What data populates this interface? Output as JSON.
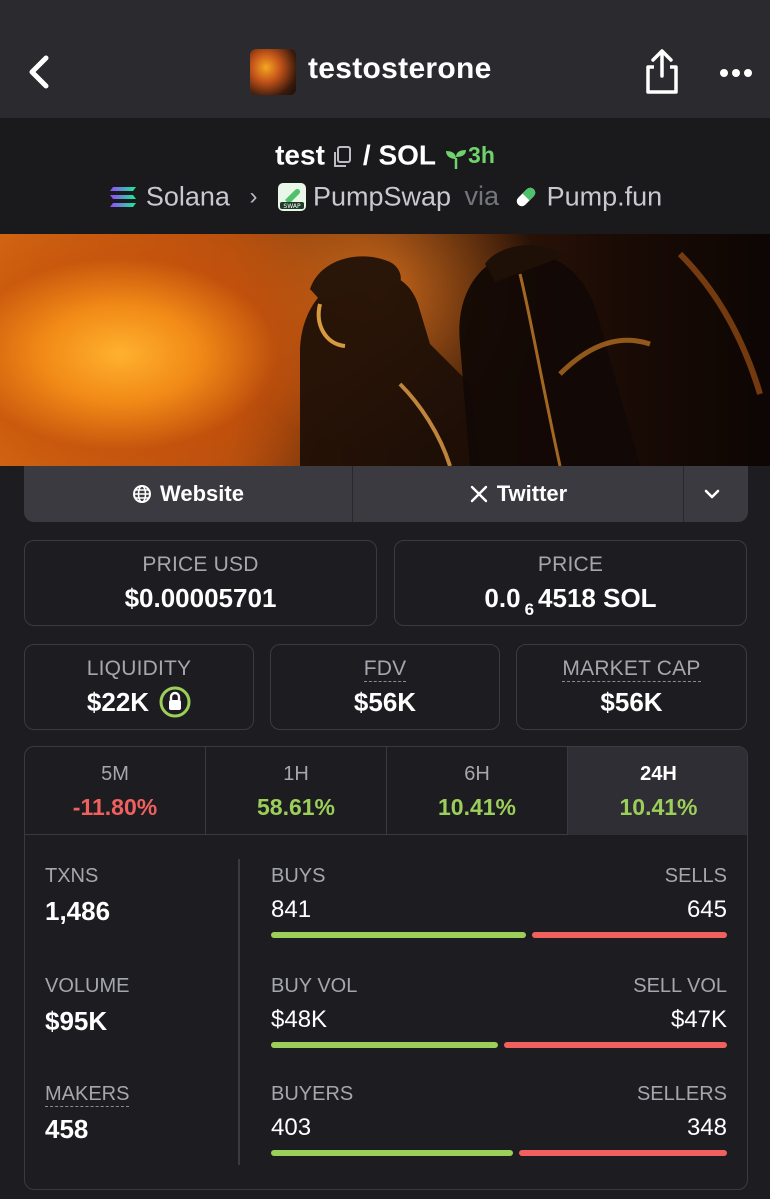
{
  "header": {
    "token_name": "testosterone"
  },
  "pair": {
    "base": "test",
    "separator": "/",
    "quote": "SOL",
    "age": "3h",
    "chain": "Solana",
    "dex": "PumpSwap",
    "via_label": "via",
    "launchpad": "Pump.fun"
  },
  "links": {
    "website": "Website",
    "twitter": "Twitter"
  },
  "stats": {
    "price_usd_label": "PRICE USD",
    "price_usd": "$0.00005701",
    "price_label": "PRICE",
    "price_prefix": "0.0",
    "price_subscript": "6",
    "price_suffix": "4518 SOL",
    "liquidity_label": "LIQUIDITY",
    "liquidity": "$22K",
    "fdv_label": "FDV",
    "fdv": "$56K",
    "mcap_label": "MARKET CAP",
    "mcap": "$56K"
  },
  "timeframes": [
    {
      "label": "5M",
      "change": "-11.80%"
    },
    {
      "label": "1H",
      "change": "58.61%"
    },
    {
      "label": "6H",
      "change": "10.41%"
    },
    {
      "label": "24H",
      "change": "10.41%"
    }
  ],
  "active_timeframe": "24H",
  "metrics": {
    "txns_label": "TXNS",
    "txns": "1,486",
    "volume_label": "VOLUME",
    "volume": "$95K",
    "makers_label": "MAKERS",
    "makers": "458"
  },
  "breakdown": {
    "buys_label": "BUYS",
    "buys": "841",
    "sells_label": "SELLS",
    "sells": "645",
    "buy_share": 0.566,
    "buy_vol_label": "BUY VOL",
    "buy_vol": "$48K",
    "sell_vol_label": "SELL VOL",
    "sell_vol": "$47K",
    "buy_vol_share": 0.505,
    "buyers_label": "BUYERS",
    "buyers": "403",
    "sellers_label": "SELLERS",
    "sellers": "348",
    "buyers_share": 0.537
  },
  "colors": {
    "positive": "#9ccf5a",
    "negative": "#f0605f",
    "age": "#6fd26c"
  }
}
